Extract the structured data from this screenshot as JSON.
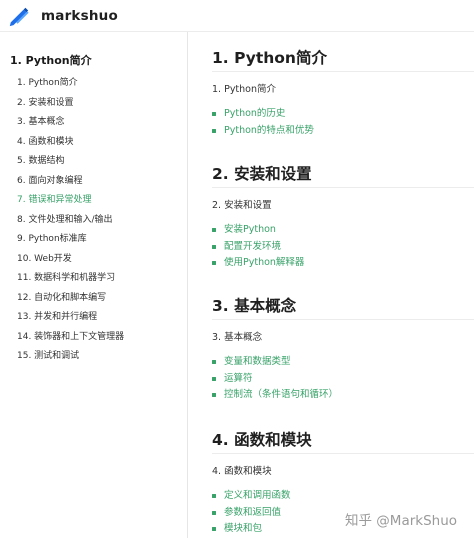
{
  "header": {
    "logo_icon": "pencil-logo-icon",
    "brand": "markshuo"
  },
  "sidebar": {
    "title": "1. Python简介",
    "active_index": 6,
    "accent_color": "#38a269",
    "items": [
      "1. Python简介",
      "2. 安装和设置",
      "3. 基本概念",
      "4. 函数和模块",
      "5. 数据结构",
      "6. 面向对象编程",
      "7. 错误和异常处理",
      "8. 文件处理和输入/输出",
      "9. Python标准库",
      "10. Web开发",
      "11. 数据科学和机器学习",
      "12. 自动化和脚本编写",
      "13. 并发和并行编程",
      "14. 装饰器和上下文管理器",
      "15. 测试和调试"
    ]
  },
  "sections": [
    {
      "heading": "1. Python简介",
      "intro": "1. Python简介",
      "links": [
        "Python的历史",
        "Python的特点和优势"
      ]
    },
    {
      "heading": "2. 安装和设置",
      "intro": "2. 安装和设置",
      "links": [
        "安装Python",
        "配置开发环境",
        "使用Python解释器"
      ]
    },
    {
      "heading": "3. 基本概念",
      "intro": "3. 基本概念",
      "links": [
        "变量和数据类型",
        "运算符",
        "控制流（条件语句和循环）"
      ]
    },
    {
      "heading": "4. 函数和模块",
      "intro": "4. 函数和模块",
      "links": [
        "定义和调用函数",
        "参数和返回值",
        "模块和包"
      ]
    }
  ],
  "watermark": "知乎 @MarkShuo"
}
